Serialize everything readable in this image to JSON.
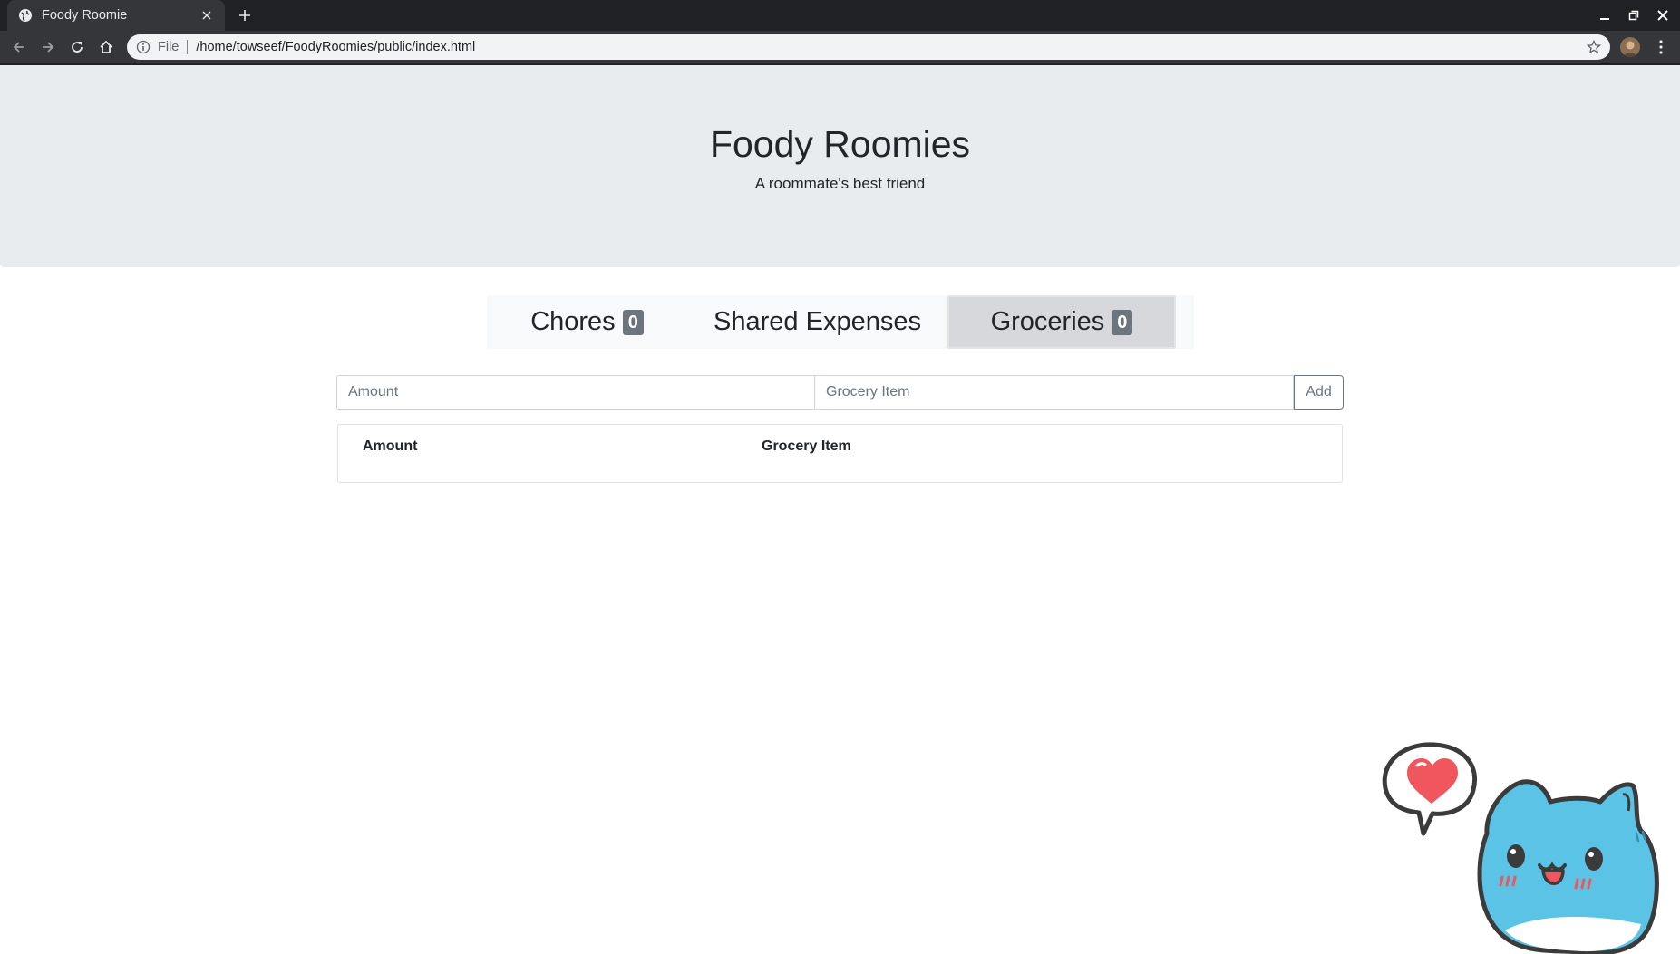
{
  "browser": {
    "tab_title": "Foody Roomie",
    "scheme": "File",
    "url": "/home/towseef/FoodyRoomies/public/index.html"
  },
  "jumbotron": {
    "title": "Foody Roomies",
    "subtitle": "A roommate's best friend"
  },
  "nav": {
    "items": [
      {
        "label": "Chores",
        "badge": "0"
      },
      {
        "label": "Shared Expenses"
      },
      {
        "label": "Groceries",
        "badge": "0",
        "active": true
      }
    ]
  },
  "form": {
    "amount_placeholder": "Amount",
    "item_placeholder": "Grocery Item",
    "add_label": "Add"
  },
  "table": {
    "headers": [
      "Amount",
      "Grocery Item"
    ],
    "rows": []
  },
  "colors": {
    "jumbotron_bg": "#e9ecef",
    "badge_bg": "#6c757d",
    "active_tab_bg": "#d6d8db",
    "mascot_body": "#5bc3e6"
  }
}
